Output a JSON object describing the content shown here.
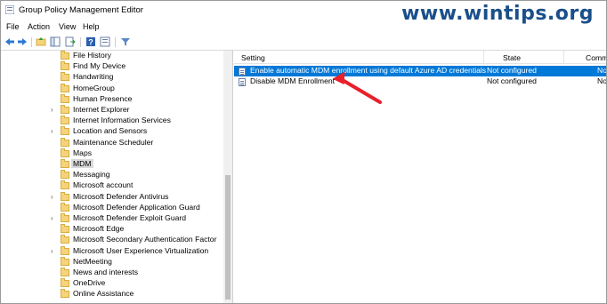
{
  "window": {
    "title": "Group Policy Management Editor"
  },
  "watermark": "www.wintips.org",
  "menu": [
    "File",
    "Action",
    "View",
    "Help"
  ],
  "toolbar": {
    "icons": [
      "back-icon",
      "forward-icon",
      "up-folder-icon",
      "show-hide-tree-icon",
      "export-icon",
      "help-icon",
      "properties-icon",
      "filter-icon"
    ]
  },
  "tree": {
    "items": [
      {
        "label": "File History",
        "expandable": false
      },
      {
        "label": "Find My Device",
        "expandable": false
      },
      {
        "label": "Handwriting",
        "expandable": false
      },
      {
        "label": "HomeGroup",
        "expandable": false
      },
      {
        "label": "Human Presence",
        "expandable": false
      },
      {
        "label": "Internet Explorer",
        "expandable": true
      },
      {
        "label": "Internet Information Services",
        "expandable": false
      },
      {
        "label": "Location and Sensors",
        "expandable": true
      },
      {
        "label": "Maintenance Scheduler",
        "expandable": false
      },
      {
        "label": "Maps",
        "expandable": false
      },
      {
        "label": "MDM",
        "expandable": false,
        "selected": true
      },
      {
        "label": "Messaging",
        "expandable": false
      },
      {
        "label": "Microsoft account",
        "expandable": false
      },
      {
        "label": "Microsoft Defender Antivirus",
        "expandable": true
      },
      {
        "label": "Microsoft Defender Application Guard",
        "expandable": false
      },
      {
        "label": "Microsoft Defender Exploit Guard",
        "expandable": true
      },
      {
        "label": "Microsoft Edge",
        "expandable": false
      },
      {
        "label": "Microsoft Secondary Authentication Factor",
        "expandable": false
      },
      {
        "label": "Microsoft User Experience Virtualization",
        "expandable": true
      },
      {
        "label": "NetMeeting",
        "expandable": false
      },
      {
        "label": "News and interests",
        "expandable": false
      },
      {
        "label": "OneDrive",
        "expandable": false
      },
      {
        "label": "Online Assistance",
        "expandable": false
      }
    ]
  },
  "list": {
    "columns": {
      "setting": "Setting",
      "state": "State",
      "comment": "Comm"
    },
    "rows": [
      {
        "setting": "Enable automatic MDM enrollment using default Azure AD credentials",
        "state": "Not configured",
        "comment": "No",
        "selected": true
      },
      {
        "setting": "Disable MDM Enrollment",
        "state": "Not configured",
        "comment": "No",
        "selected": false
      }
    ]
  },
  "colors": {
    "selection": "#0078d7",
    "annotation_arrow": "#e8202a",
    "watermark": "#1a4f8a"
  }
}
